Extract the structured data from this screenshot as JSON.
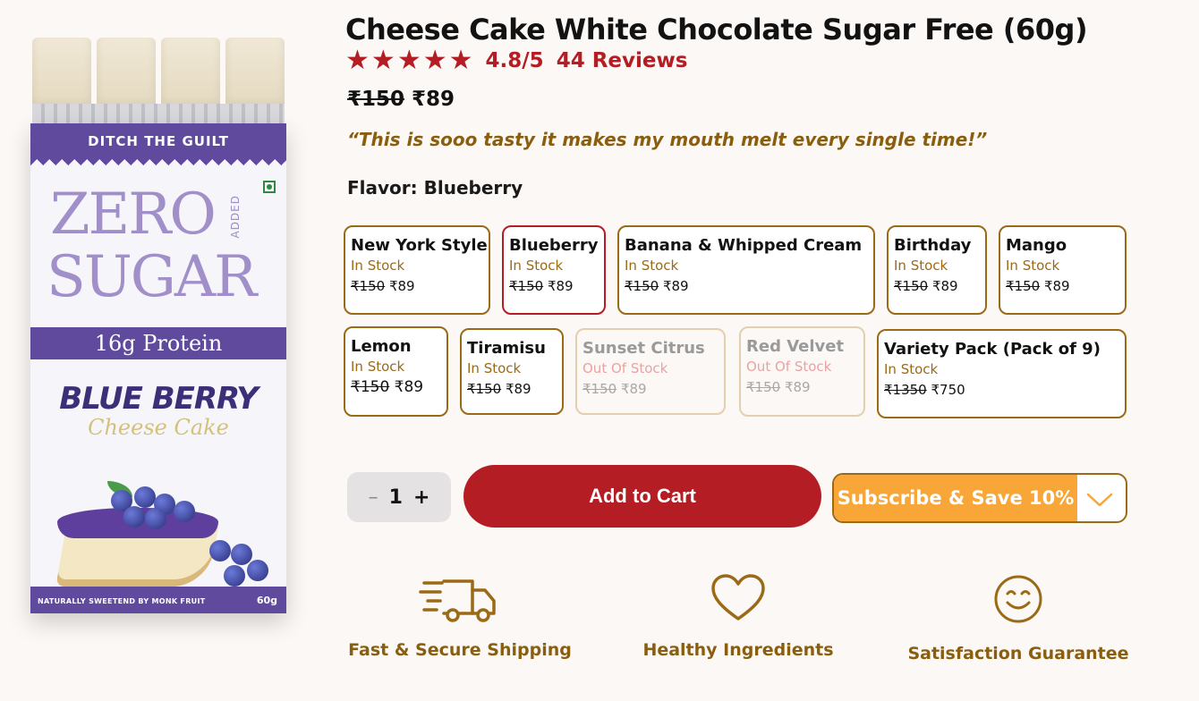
{
  "product": {
    "title": "Cheese Cake White Chocolate Sugar Free (60g)",
    "rating": "4.8/5",
    "reviews": "44 Reviews",
    "stars": 5,
    "price_old": "₹150",
    "price_new": "₹89",
    "quote": "“This is sooo tasty it makes my mouth melt every single time!”",
    "flavor_prefix": "Flavor: ",
    "flavor_selected": "Blueberry"
  },
  "packaging": {
    "tagline": "DITCH THE GUILT",
    "zero": "ZERO",
    "added": "ADDED",
    "sugar": "SUGAR",
    "protein": "16g Protein",
    "flavor_name": "BLUE BERRY",
    "flavor_sub": "Cheese Cake",
    "sweetened": "NATURALLY SWEETEND BY MONK FRUIT",
    "weight": "60g"
  },
  "flavors": [
    {
      "name": "New York Style",
      "stock": "In Stock",
      "old": "₹150",
      "new": "₹89"
    },
    {
      "name": "Blueberry",
      "stock": "In Stock",
      "old": "₹150",
      "new": "₹89"
    },
    {
      "name": "Banana & Whipped Cream",
      "stock": "In Stock",
      "old": "₹150",
      "new": "₹89"
    },
    {
      "name": "Birthday",
      "stock": "In Stock",
      "old": "₹150",
      "new": "₹89"
    },
    {
      "name": "Mango",
      "stock": "In Stock",
      "old": "₹150",
      "new": "₹89"
    },
    {
      "name": "Lemon",
      "stock": "In Stock",
      "old": "₹150",
      "new": "₹89"
    },
    {
      "name": "Tiramisu",
      "stock": "In Stock",
      "old": "₹150",
      "new": "₹89"
    },
    {
      "name": "Sunset Citrus",
      "stock": "Out Of Stock",
      "old": "₹150",
      "new": "₹89"
    },
    {
      "name": "Red Velvet",
      "stock": "Out Of Stock",
      "old": "₹150",
      "new": "₹89"
    },
    {
      "name": "Variety Pack (Pack of 9)",
      "stock": "In Stock",
      "old": "₹1350",
      "new": "₹750"
    }
  ],
  "cart": {
    "minus": "–",
    "quantity": "1",
    "plus": "+",
    "add_to_cart": "Add to Cart",
    "subscribe": "Subscribe & Save 10%"
  },
  "features": {
    "shipping": "Fast & Secure Shipping",
    "healthy": "Healthy Ingredients",
    "guarantee": "Satisfaction Guarantee"
  },
  "colors": {
    "accent_red": "#b51d24",
    "gold": "#9b6a16",
    "subscribe_orange": "#f7a637",
    "pack_purple": "#5f4a9e"
  }
}
